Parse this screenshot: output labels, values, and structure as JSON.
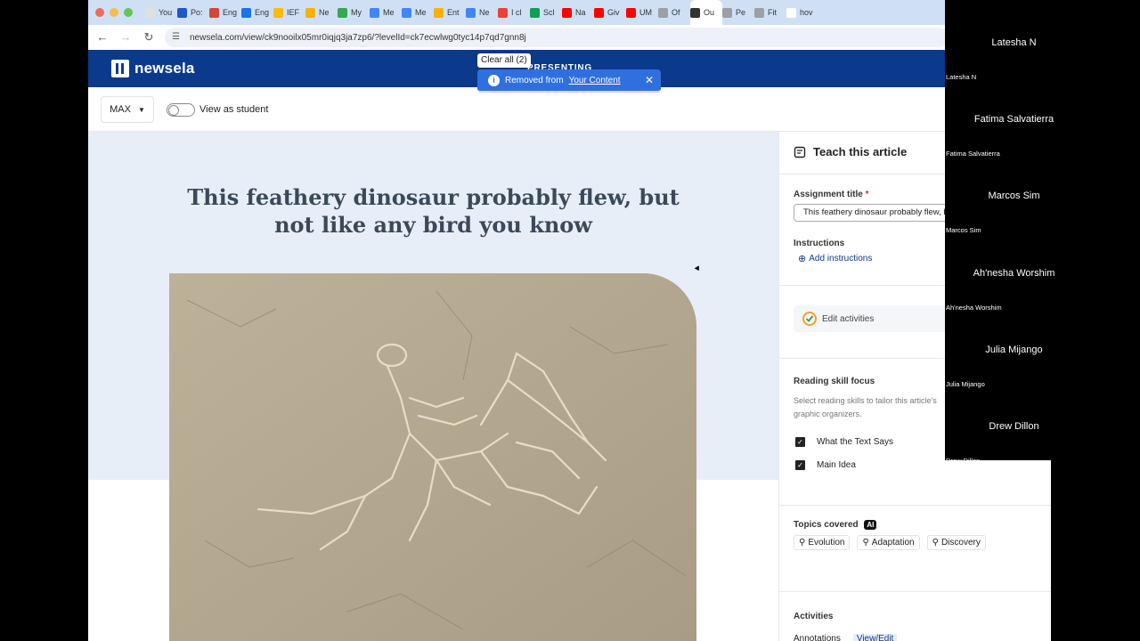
{
  "browser": {
    "tabs": [
      {
        "label": "You",
        "color": "#e0e0e0"
      },
      {
        "label": "Po:",
        "color": "#1f56c8"
      },
      {
        "label": "Eng",
        "color": "#d44638"
      },
      {
        "label": "Eng",
        "color": "#1a73e8"
      },
      {
        "label": "IEF",
        "color": "#fbbc04"
      },
      {
        "label": "Ne",
        "color": "#f4b400"
      },
      {
        "label": "My",
        "color": "#34a853"
      },
      {
        "label": "Me",
        "color": "#4285f4"
      },
      {
        "label": "Me",
        "color": "#4285f4"
      },
      {
        "label": "Ent",
        "color": "#f4b400"
      },
      {
        "label": "Ne",
        "color": "#4285f4"
      },
      {
        "label": "I cl",
        "color": "#ea4335"
      },
      {
        "label": "Scl",
        "color": "#0f9d58"
      },
      {
        "label": "Na",
        "color": "#ff0000"
      },
      {
        "label": "Giv",
        "color": "#ff0000"
      },
      {
        "label": "UM",
        "color": "#ff0000"
      },
      {
        "label": "Of",
        "color": "#9aa0a6"
      },
      {
        "label": "Ou",
        "color": "#333333"
      },
      {
        "label": "Pe",
        "color": "#9aa0a6"
      },
      {
        "label": "Fit",
        "color": "#9aa0a6"
      },
      {
        "label": "hov",
        "color": "#ffffff"
      }
    ],
    "url": "newsela.com/view/ck9nooilx05mr0iqjq3ja7zp6/?levelId=ck7ecwlwg0tyc14p7qd7gnn8j"
  },
  "newsela": {
    "logo": "newsela",
    "presenting": "PRESENTING",
    "clear_all": "Clear all (2)",
    "toast": {
      "text": "Removed from",
      "link": "Your Content"
    },
    "level": "MAX",
    "view_as_student": "View as student",
    "headline": "This feathery dinosaur probably flew, but not like any bird you know"
  },
  "panel": {
    "title": "Teach this article",
    "assignment_title_label": "Assignment title",
    "required": "*",
    "assignment_title_value": "This feathery dinosaur probably flew, but not like any bird you know",
    "instructions_label": "Instructions",
    "add_instructions": "Add instructions",
    "edit_activities": "Edit activities",
    "reading_skill_label": "Reading skill focus",
    "reading_skill_helper": "Select reading skills to tailor this article's graphic organizers.",
    "skills": [
      "What the Text Says",
      "Main Idea"
    ],
    "topics_label": "Topics covered",
    "ai_badge": "AI",
    "topics": [
      "Evolution",
      "Adaptation",
      "Discovery"
    ],
    "activities_label": "Activities",
    "annotations": "Annotations",
    "view_edit": "View/Edit"
  },
  "participants": [
    {
      "name": "Latesha N",
      "label": "Latesha N"
    },
    {
      "name": "Fatima Salvatierra",
      "label": "Fatima Salvatierra"
    },
    {
      "name": "Marcos Sim",
      "label": "Marcos Sim"
    },
    {
      "name": "Ah'nesha Worshim",
      "label": "Ah'nesha Worshim"
    },
    {
      "name": "Julia Mijango",
      "label": "Julia Mijango"
    },
    {
      "name": "Drew Dillon",
      "label": "Drew Dillon"
    }
  ]
}
